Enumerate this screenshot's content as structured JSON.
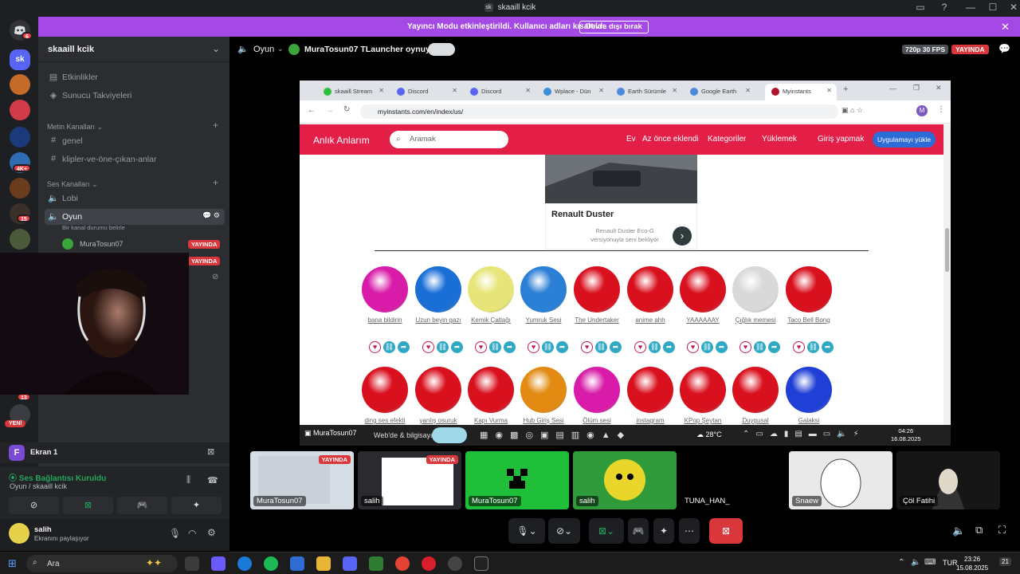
{
  "window": {
    "title": "skaaill kcik",
    "logo": "sk"
  },
  "banner": {
    "text": "Yayıncı Modu etkinleştirildi. Kullanıcı adları kısaltıldı.",
    "button": "Devre dışı bırak"
  },
  "server_badges": [
    "6",
    "4K+",
    "15",
    "13",
    "YENİ"
  ],
  "sidebar": {
    "server_name": "skaaill kcik",
    "top_items": [
      "Etkinlikler",
      "Sunucu Takviyeleri"
    ],
    "text_category": "Metin Kanalları",
    "text_channels": [
      "genel",
      "klipler-ve-öne-çıkan-anlar"
    ],
    "voice_category": "Ses Kanalları",
    "voice_channels": [
      "Lobi",
      "Oyun"
    ],
    "oyun_status": "Bir kanal durumu belirle",
    "voice_user": "MuraTosun07",
    "live_label": "YAYINDA"
  },
  "screen": {
    "label": "Ekran 1",
    "avatar_letter": "F"
  },
  "voice_panel": {
    "status": "Ses Bağlantısı Kuruldu",
    "channel": "Oyun / skaaill kcik"
  },
  "user": {
    "name": "salih",
    "status": "Ekranını paylaşıyor"
  },
  "stage": {
    "channel": "Oyun",
    "activity": "MuraTosun07 TLauncher oynuyor",
    "quality": "720p 30 FPS",
    "live": "YAYINDA"
  },
  "browser": {
    "tabs": [
      {
        "label": "skaaill Stream",
        "color": "#2fbf3a"
      },
      {
        "label": "Discord",
        "color": "#5865f2"
      },
      {
        "label": "Discord",
        "color": "#5865f2"
      },
      {
        "label": "Wplace - Dün",
        "color": "#3a8fd6"
      },
      {
        "label": "Earth Sürümle",
        "color": "#4a89dc"
      },
      {
        "label": "Google Earth",
        "color": "#4a89dc"
      },
      {
        "label": "Myinstants",
        "color": "#b3122e"
      }
    ],
    "url": "myinstants.com/en/index/us/",
    "profile": "M"
  },
  "site": {
    "brand": "Anlık Anlarım",
    "search_placeholder": "Aramak",
    "nav": [
      "Ev",
      "Az önce eklendi",
      "Kategoriler",
      "Yüklemek",
      "Giriş yapmak"
    ],
    "cta": "Uygulamayı yükle",
    "ad_title": "Renault Duster",
    "ad_desc": "Renault Duster Eco-G versiyonuyla seni bekliyor"
  },
  "sounds_row1": [
    {
      "label": "bana bildirin",
      "color": "#d81ba8"
    },
    {
      "label": "Uzun beyin gazı",
      "color": "#1a6fd6"
    },
    {
      "label": "Kemik Çatlağı",
      "color": "#e7e57a"
    },
    {
      "label": "Yumruk Sesi",
      "color": "#2a7fd6"
    },
    {
      "label": "The Undertaker",
      "color": "#d9101e"
    },
    {
      "label": "anime ahh",
      "color": "#d9101e"
    },
    {
      "label": "YAAAAAAY",
      "color": "#d9101e"
    },
    {
      "label": "Çığlık memesi",
      "color": "#d9d9d9"
    },
    {
      "label": "Taco Bell Bong",
      "color": "#d9101e"
    }
  ],
  "sounds_row2": [
    {
      "label": "ding ses efekti",
      "color": "#d9101e"
    },
    {
      "label": "yanlış osuruk",
      "color": "#d9101e"
    },
    {
      "label": "Kapı Vurma",
      "color": "#d9101e"
    },
    {
      "label": "Hub Giriş Sesi",
      "color": "#e28a12"
    },
    {
      "label": "Ölüm sesi",
      "color": "#d81ba8"
    },
    {
      "label": "instagram",
      "color": "#d9101e"
    },
    {
      "label": "KPop Şeytan",
      "color": "#d9101e"
    },
    {
      "label": "Duygusal",
      "color": "#d9101e"
    },
    {
      "label": "Galaksi",
      "color": "#1f3fd6"
    }
  ],
  "inner_taskbar": {
    "tooltip": "MuraTosun07",
    "weather": "28°C",
    "search_text": "Web'de & bilgisayarda",
    "time": "04:26",
    "date": "16.08.2025"
  },
  "tiles": [
    {
      "name": "MuraTosun07",
      "live": "YAYINDA"
    },
    {
      "name": "salih",
      "live": "YAYINDA"
    },
    {
      "name": "MuraTosun07"
    },
    {
      "name": "salih"
    },
    {
      "name": "TUNA_HAN_"
    },
    {
      "name": "Snaew"
    },
    {
      "name": "Çöl Fatihi"
    }
  ],
  "taskbar": {
    "search": "Ara",
    "lang": "TUR",
    "time": "23:26",
    "date": "15.08.2025",
    "notif": "21"
  }
}
